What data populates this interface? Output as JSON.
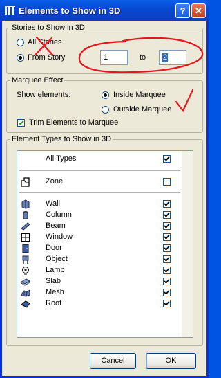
{
  "window": {
    "title": "Elements to Show in 3D",
    "help_label": "?",
    "close_label": "✕"
  },
  "stories": {
    "legend": "Stories to Show in 3D",
    "all_label": "All Stories",
    "from_label": "From Story",
    "from_value": "1",
    "to_label": "to",
    "to_value": "2"
  },
  "marquee": {
    "legend": "Marquee Effect",
    "show_label": "Show elements:",
    "inside_label": "Inside Marquee",
    "outside_label": "Outside Marquee",
    "trim_label": "Trim Elements to Marquee"
  },
  "types": {
    "legend": "Element Types to Show in 3D",
    "all_types": {
      "label": "All Types",
      "checked": true
    },
    "zone": {
      "label": "Zone",
      "checked": false
    },
    "items": [
      {
        "label": "Wall",
        "icon": "wall-icon",
        "checked": true
      },
      {
        "label": "Column",
        "icon": "column-icon",
        "checked": true
      },
      {
        "label": "Beam",
        "icon": "beam-icon",
        "checked": true
      },
      {
        "label": "Window",
        "icon": "window-icon",
        "checked": true
      },
      {
        "label": "Door",
        "icon": "door-icon",
        "checked": true
      },
      {
        "label": "Object",
        "icon": "object-icon",
        "checked": true
      },
      {
        "label": "Lamp",
        "icon": "lamp-icon",
        "checked": true
      },
      {
        "label": "Slab",
        "icon": "slab-icon",
        "checked": true
      },
      {
        "label": "Mesh",
        "icon": "mesh-icon",
        "checked": true
      },
      {
        "label": "Roof",
        "icon": "roof-icon",
        "checked": true
      }
    ]
  },
  "buttons": {
    "cancel": "Cancel",
    "ok": "OK"
  },
  "annotation_colors": {
    "red": "#e8141c"
  }
}
